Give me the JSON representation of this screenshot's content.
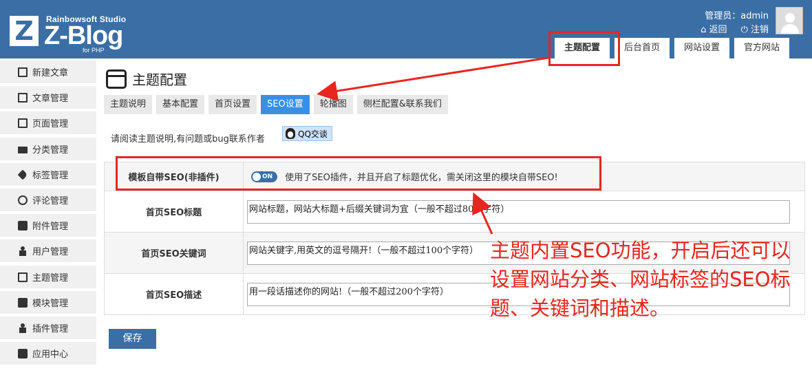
{
  "brand": {
    "logo_letter": "Z",
    "studio": "Rainbowsoft Studio",
    "name": "Z-Blog",
    "sub": "for PHP"
  },
  "user": {
    "label": "管理员：admin",
    "back": "返回",
    "logout": "注销",
    "back_icon": "home-icon",
    "logout_icon": "power-icon"
  },
  "top_tabs": [
    "主题配置",
    "后台首页",
    "网站设置",
    "官方网站"
  ],
  "sidebar": [
    {
      "label": "新建文章",
      "icon": "edit-icon"
    },
    {
      "label": "文章管理",
      "icon": "document-icon"
    },
    {
      "label": "页面管理",
      "icon": "copy-icon"
    },
    {
      "label": "分类管理",
      "icon": "folder-icon"
    },
    {
      "label": "标签管理",
      "icon": "tag-icon"
    },
    {
      "label": "评论管理",
      "icon": "comment-icon"
    },
    {
      "label": "附件管理",
      "icon": "attachment-icon"
    },
    {
      "label": "用户管理",
      "icon": "user-icon"
    },
    {
      "label": "主题管理",
      "icon": "theme-icon"
    },
    {
      "label": "模块管理",
      "icon": "module-icon"
    },
    {
      "label": "插件管理",
      "icon": "plugin-icon"
    },
    {
      "label": "应用中心",
      "icon": "box-icon"
    }
  ],
  "page_title": "主题配置",
  "sub_tabs": [
    "主题说明",
    "基本配置",
    "首页设置",
    "SEO设置",
    "轮播图",
    "侧栏配置&联系我们"
  ],
  "notice": "请阅读主题说明,有问题或bug联系作者",
  "qq_button": "QQ交谈",
  "form": {
    "seo_toggle_label": "模板自带SEO(非插件)",
    "seo_toggle_state": "ON",
    "seo_toggle_note": "使用了SEO插件，并且开启了标题优化，需关闭这里的模块自带SEO!",
    "rows": [
      {
        "label": "首页SEO标题",
        "value": "网站标题，网站大标题+后缀关键词为宜（一般不超过80个字符）"
      },
      {
        "label": "首页SEO关键词",
        "value": "网站关键字,用英文的逗号隔开!（一般不超过100个字符）"
      },
      {
        "label": "首页SEO描述",
        "value": "用一段话描述你的网站!（一般不超过200个字符）"
      }
    ]
  },
  "save_button": "保存",
  "annotation": "主题内置SEO功能，开启后还可以设置网站分类、网站标签的SEO标题、关键词和描述。",
  "colors": {
    "header": "#3a6ea5",
    "active_tab": "#3a8ee6",
    "annotation": "#e8251f",
    "sidebar_bg": "#f0f0f0"
  }
}
